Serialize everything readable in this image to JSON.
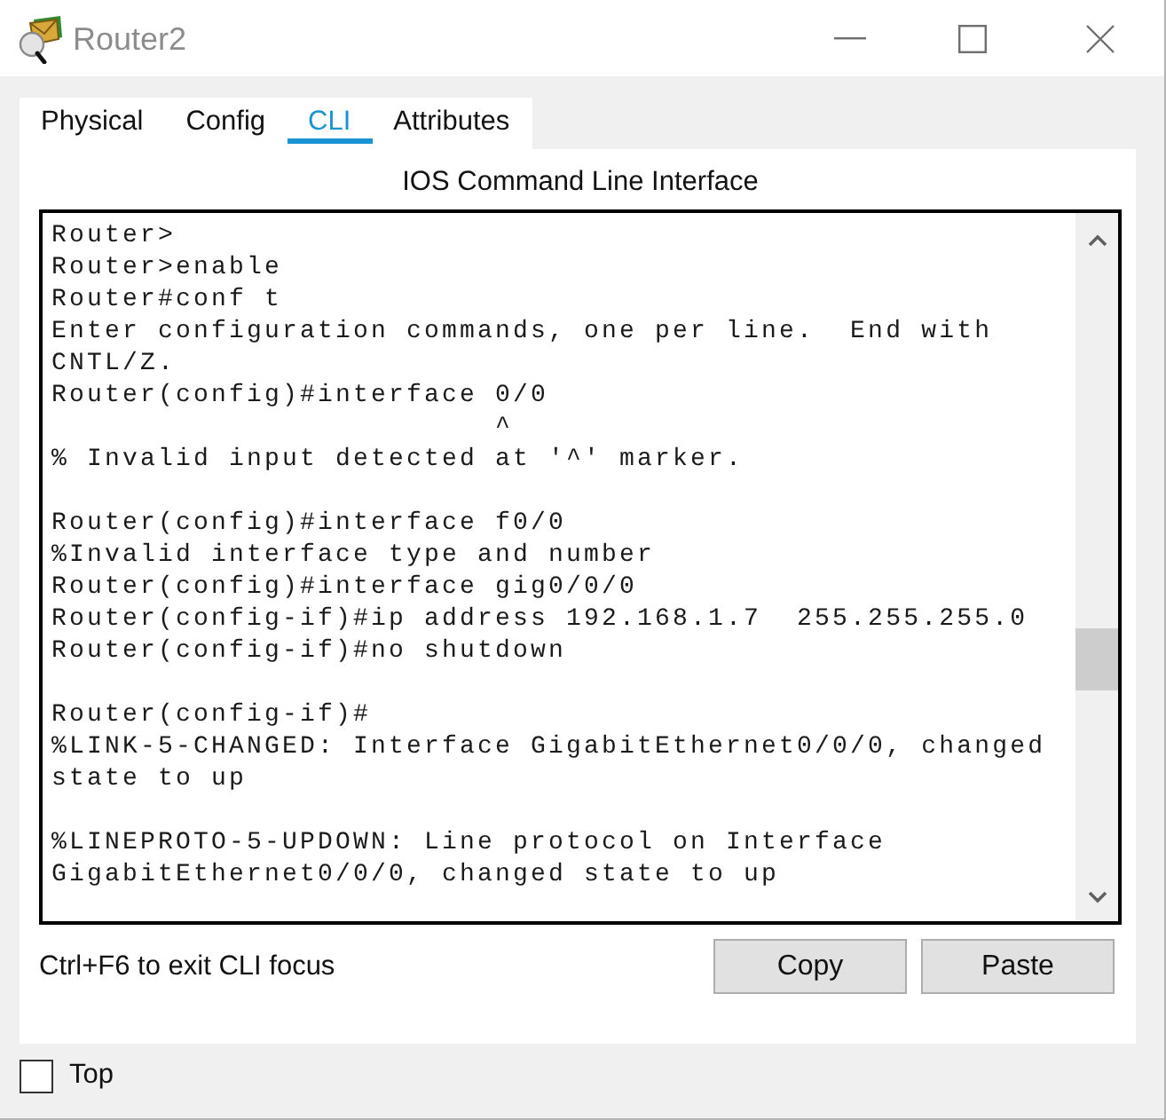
{
  "window": {
    "title": "Router2"
  },
  "tabs": [
    {
      "label": "Physical",
      "selected": false
    },
    {
      "label": "Config",
      "selected": false
    },
    {
      "label": "CLI",
      "selected": true
    },
    {
      "label": "Attributes",
      "selected": false
    }
  ],
  "cli": {
    "heading": "IOS Command Line Interface",
    "blocks": [
      [
        "Router>",
        "Router>enable",
        "Router#conf t",
        "Enter configuration commands, one per line.  End with",
        "CNTL/Z.",
        "Router(config)#interface 0/0",
        "                         ^",
        "% Invalid input detected at '^' marker."
      ],
      [
        "Router(config)#interface f0/0",
        "%Invalid interface type and number",
        "Router(config)#interface gig0/0/0",
        "Router(config-if)#ip address 192.168.1.7  255.255.255.0",
        "Router(config-if)#no shutdown"
      ],
      [
        "Router(config-if)#",
        "%LINK-5-CHANGED: Interface GigabitEthernet0/0/0, changed",
        "state to up"
      ],
      [
        "%LINEPROTO-5-UPDOWN: Line protocol on Interface",
        "GigabitEthernet0/0/0, changed state to up"
      ]
    ],
    "hint": "Ctrl+F6 to exit CLI focus",
    "buttons": [
      "Copy",
      "Paste"
    ]
  },
  "top_checkbox": {
    "label": "Top",
    "checked": false
  }
}
